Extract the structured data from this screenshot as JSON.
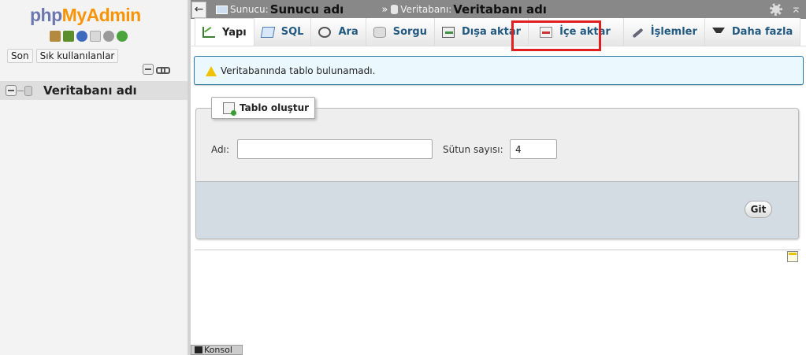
{
  "navigation": {
    "logo": {
      "php": "php",
      "myadmin": "MyAdmin"
    },
    "icons": [
      "home-icon",
      "exit-icon",
      "help-icon",
      "documentation-icon",
      "settings-icon",
      "reload-icon"
    ],
    "buttons": {
      "recent": "Son",
      "favorites": "Sık kullanılanlar"
    },
    "tree": [
      {
        "name": "Veritabanı adı"
      }
    ]
  },
  "breadcrumb": {
    "server_label": "Sunucu:",
    "server_value": "Sunucu adı",
    "separator": "»",
    "database_label": "Veritabanı:",
    "database_value": "Veritabanı adı"
  },
  "tabs": [
    {
      "label": "Yapı",
      "icon": "structure-icon",
      "active": true
    },
    {
      "label": "SQL",
      "icon": "sql-icon"
    },
    {
      "label": "Ara",
      "icon": "search-icon"
    },
    {
      "label": "Sorgu",
      "icon": "query-icon"
    },
    {
      "label": "Dışa aktar",
      "icon": "export-icon"
    },
    {
      "label": "İçe aktar",
      "icon": "import-icon",
      "highlighted": true
    },
    {
      "label": "İşlemler",
      "icon": "operations-icon"
    },
    {
      "label": "Daha fazla",
      "icon": "caret-down-icon"
    }
  ],
  "notice": {
    "text": "Veritabanında tablo bulunamadı."
  },
  "create_table": {
    "legend": "Tablo oluştur",
    "name_label": "Adı:",
    "name_value": "",
    "columns_label": "Sütun sayısı:",
    "columns_value": "4",
    "submit": "Git"
  },
  "console": {
    "label": "Konsol"
  },
  "colors": {
    "accent": "#235a81",
    "highlight_box": "#e02020",
    "notice_bg": "#ebf8fd",
    "topbar": "#888888"
  }
}
